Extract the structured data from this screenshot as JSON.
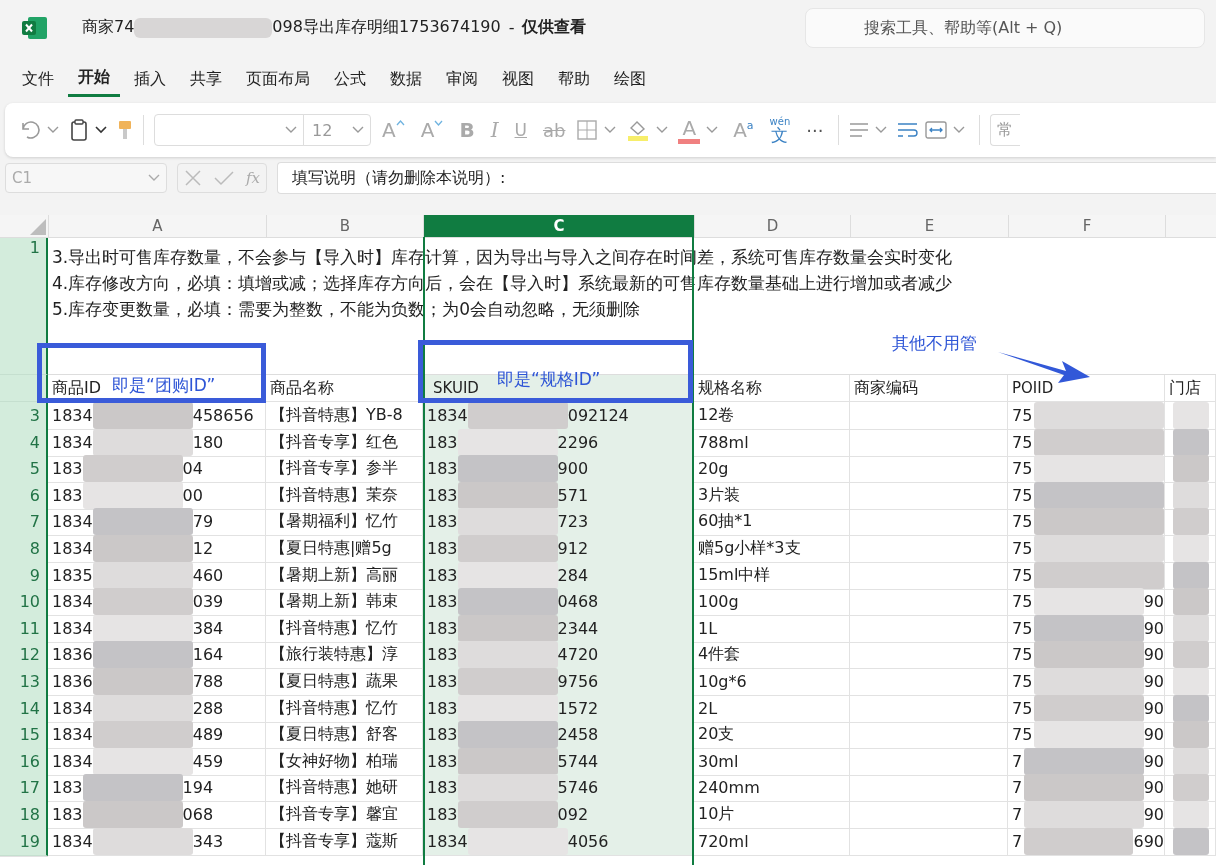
{
  "window": {
    "title_start": "商家74",
    "title_end": "098导出库存明细1753674190",
    "separator": "-",
    "mode": "仅供查看"
  },
  "search": {
    "placeholder": "搜索工具、帮助等(Alt + Q)"
  },
  "tabs": [
    {
      "label": "文件",
      "selected": false
    },
    {
      "label": "开始",
      "selected": true
    },
    {
      "label": "插入",
      "selected": false
    },
    {
      "label": "共享",
      "selected": false
    },
    {
      "label": "页面布局",
      "selected": false
    },
    {
      "label": "公式",
      "selected": false
    },
    {
      "label": "数据",
      "selected": false
    },
    {
      "label": "审阅",
      "selected": false
    },
    {
      "label": "视图",
      "selected": false
    },
    {
      "label": "帮助",
      "selected": false
    },
    {
      "label": "绘图",
      "selected": false
    }
  ],
  "ribbon": {
    "font_size": "12",
    "grow": "A",
    "shrink": "A",
    "bold": "B",
    "italic": "I",
    "underline": "U",
    "strike": "ab",
    "font_color": "A",
    "style": "A",
    "style_small": "a",
    "phonetic_top": "wén",
    "phonetic_bottom": "文",
    "more": "···",
    "cut_label": "常"
  },
  "formula_bar": {
    "cell": "C1",
    "fx": "fx",
    "content": "填写说明（请勿删除本说明）:"
  },
  "sheet": {
    "columns": [
      {
        "letter": "A",
        "selected": false
      },
      {
        "letter": "B",
        "selected": false
      },
      {
        "letter": "C",
        "selected": true
      },
      {
        "letter": "D",
        "selected": false
      },
      {
        "letter": "E",
        "selected": false
      },
      {
        "letter": "F",
        "selected": false
      }
    ],
    "notes": [
      "3.导出时可售库存数量，不会参与【导入时】库存计算，因为导出与导入之间存在时间差，系统可售库存数量会实时变化",
      "4.库存修改方向，必填：填增或减；选择库存方向后，会在【导入时】系统最新的可售库存数量基础上进行增加或者减少",
      "5.库存变更数量，必填：需要为整数，不能为负数；为0会自动忽略，无须删除"
    ],
    "first_row": "1",
    "headers": [
      "商品ID",
      "商品名称",
      "SKUID",
      "规格名称",
      "商家编码",
      "POIID",
      "门店"
    ],
    "rows": [
      {
        "number": "3",
        "id": [
          "1834",
          "458656"
        ],
        "name": "【抖音特惠】YB-8",
        "sku": [
          "1834",
          "092124"
        ],
        "spec": "12卷",
        "poi": [
          "75"
        ]
      },
      {
        "number": "4",
        "id": [
          "1834",
          "180"
        ],
        "name": "【抖音专享】红色",
        "sku": [
          "183",
          "2296"
        ],
        "spec": "788ml",
        "poi": [
          "75"
        ]
      },
      {
        "number": "5",
        "id": [
          "183",
          "04"
        ],
        "name": "【抖音专享】参半",
        "sku": [
          "183",
          "900"
        ],
        "spec": "20g",
        "poi": [
          "75"
        ]
      },
      {
        "number": "6",
        "id": [
          "183",
          "00"
        ],
        "name": "【抖音特惠】茉奈",
        "sku": [
          "183",
          "571"
        ],
        "spec": "3片装",
        "poi": [
          "75"
        ]
      },
      {
        "number": "7",
        "id": [
          "1834",
          "79"
        ],
        "name": "【暑期福利】忆竹",
        "sku": [
          "183",
          "723"
        ],
        "spec": "60抽*1",
        "poi": [
          "75"
        ]
      },
      {
        "number": "8",
        "id": [
          "1834",
          "12"
        ],
        "name": "【夏日特惠|赠5g",
        "sku": [
          "183",
          "912"
        ],
        "spec": "赠5g小样*3支",
        "poi": [
          "75"
        ]
      },
      {
        "number": "9",
        "id": [
          "1835",
          "460"
        ],
        "name": "【暑期上新】高丽",
        "sku": [
          "183",
          "284"
        ],
        "spec": "15ml中样",
        "poi": [
          "75"
        ]
      },
      {
        "number": "10",
        "id": [
          "1834",
          "039"
        ],
        "name": "【暑期上新】韩束",
        "sku": [
          "183",
          "0468"
        ],
        "spec": "100g",
        "poi": [
          "75",
          "90"
        ]
      },
      {
        "number": "11",
        "id": [
          "1834",
          "384"
        ],
        "name": "【抖音特惠】忆竹",
        "sku": [
          "183",
          "2344"
        ],
        "spec": "1L",
        "poi": [
          "75",
          "90"
        ]
      },
      {
        "number": "12",
        "id": [
          "1836",
          "164"
        ],
        "name": "【旅行装特惠】淳",
        "sku": [
          "183",
          "4720"
        ],
        "spec": "4件套",
        "poi": [
          "75",
          "90"
        ]
      },
      {
        "number": "13",
        "id": [
          "1836",
          "788"
        ],
        "name": "【夏日特惠】蔬果",
        "sku": [
          "183",
          "9756"
        ],
        "spec": "10g*6",
        "poi": [
          "75",
          "90"
        ]
      },
      {
        "number": "14",
        "id": [
          "1834",
          "288"
        ],
        "name": "【抖音特惠】忆竹",
        "sku": [
          "183",
          "1572"
        ],
        "spec": "2L",
        "poi": [
          "75",
          "90"
        ]
      },
      {
        "number": "15",
        "id": [
          "1834",
          "489"
        ],
        "name": "【夏日特惠】舒客",
        "sku": [
          "183",
          "2458"
        ],
        "spec": "20支",
        "poi": [
          "75",
          "90"
        ]
      },
      {
        "number": "16",
        "id": [
          "1834",
          "459"
        ],
        "name": "【女神好物】柏瑞",
        "sku": [
          "183",
          "5744"
        ],
        "spec": "30ml",
        "poi": [
          "7",
          "90"
        ]
      },
      {
        "number": "17",
        "id": [
          "183",
          "194"
        ],
        "name": "【抖音特惠】她研",
        "sku": [
          "183",
          "5746"
        ],
        "spec": "240mm",
        "poi": [
          "7",
          "90"
        ]
      },
      {
        "number": "18",
        "id": [
          "183",
          "068"
        ],
        "name": "【抖音专享】馨宜",
        "sku": [
          "183",
          "092"
        ],
        "spec": "10片",
        "poi": [
          "7",
          "90"
        ]
      },
      {
        "number": "19",
        "id": [
          "1834",
          "343"
        ],
        "name": "【抖音专享】蔻斯",
        "sku": [
          "1834",
          "4056"
        ],
        "spec": "720ml",
        "poi": [
          "7",
          "690"
        ]
      }
    ]
  },
  "annotations": {
    "boxes": [
      {
        "text": "即是“团购ID”"
      },
      {
        "text": "即是“规格ID”"
      }
    ],
    "callout": "其他不用管"
  }
}
